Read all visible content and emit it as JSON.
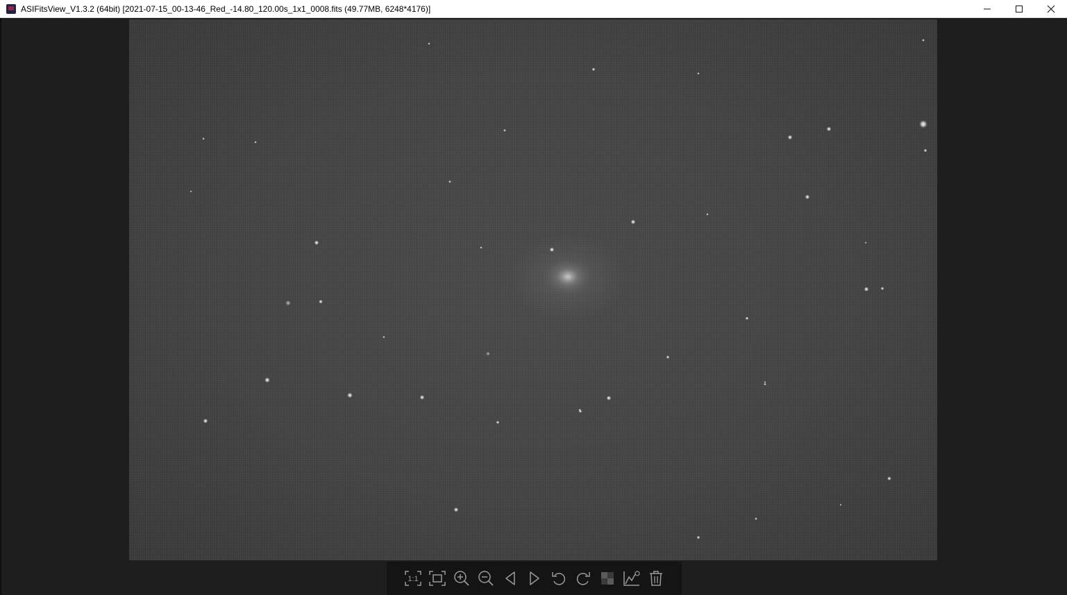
{
  "window": {
    "title": "ASIFitsView_V1.3.2 (64bit) [2021-07-15_00-13-46_Red_-14.80_120.00s_1x1_0008.fits (49.77MB, 6248*4176)]",
    "controls": [
      "minimize-icon",
      "maximize-icon",
      "close-icon"
    ]
  },
  "viewer": {
    "background_color": "#1e1e1e",
    "image_tone": "#444444"
  },
  "toolbar": {
    "actual_size_label": "1:1",
    "buttons": [
      "actual-size-icon",
      "fit-window-icon",
      "zoom-in-icon",
      "zoom-out-icon",
      "previous-icon",
      "next-icon",
      "rotate-left-icon",
      "rotate-right-icon",
      "debayer-icon",
      "histogram-icon",
      "delete-icon"
    ]
  }
}
